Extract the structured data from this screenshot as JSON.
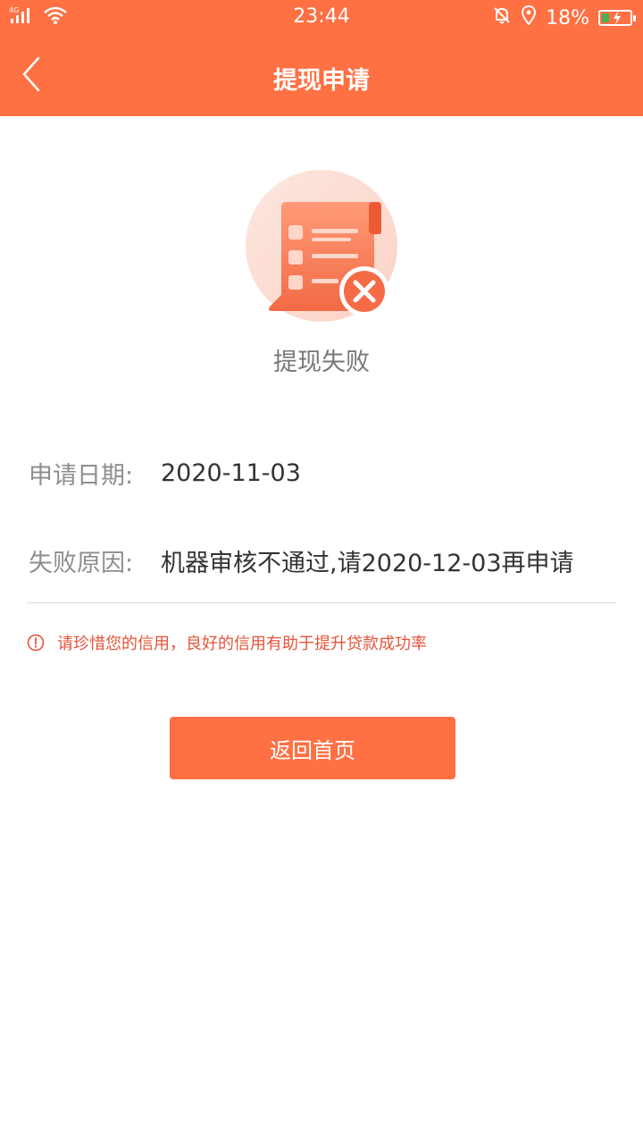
{
  "status_bar": {
    "network": "4G",
    "time": "23:44",
    "battery": "18%"
  },
  "nav": {
    "title": "提现申请",
    "back_icon": "chevron-left-icon"
  },
  "result": {
    "icon": "document-failed-icon",
    "title": "提现失败"
  },
  "details": [
    {
      "label": "申请日期:",
      "value": "2020-11-03"
    },
    {
      "label": "失败原因:",
      "value": "机器审核不通过,请2020-12-03再申请"
    }
  ],
  "tip": {
    "icon": "alert-circle-icon",
    "text": "请珍惜您的信用，良好的信用有助于提升贷款成功率"
  },
  "actions": {
    "home_label": "返回首页"
  },
  "colors": {
    "primary": "#FF7043",
    "warning_text": "#E5533A",
    "label_text": "#8e8e8e",
    "value_text": "#333333"
  }
}
